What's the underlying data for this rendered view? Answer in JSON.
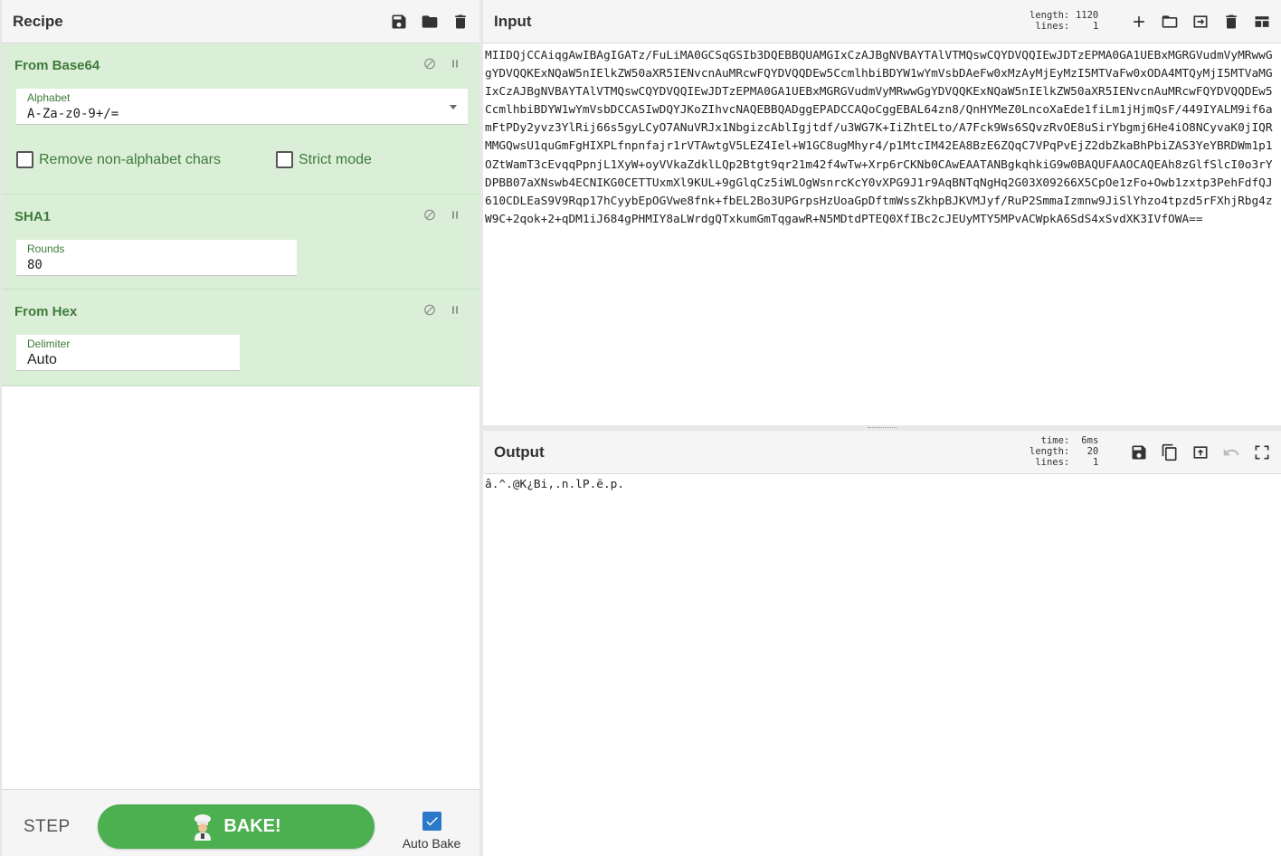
{
  "recipe": {
    "title": "Recipe",
    "header_icons": [
      "save-icon",
      "folder-icon",
      "trash-icon"
    ],
    "operations": [
      {
        "title": "From Base64",
        "alphabet_label": "Alphabet",
        "alphabet_value": "A-Za-z0-9+/=",
        "remove_non_alphabet_label": "Remove non-alphabet chars",
        "remove_non_alphabet_checked": false,
        "strict_mode_label": "Strict mode",
        "strict_mode_checked": false
      },
      {
        "title": "SHA1",
        "rounds_label": "Rounds",
        "rounds_value": "80"
      },
      {
        "title": "From Hex",
        "delimiter_label": "Delimiter",
        "delimiter_value": "Auto"
      }
    ],
    "footer": {
      "step_label": "STEP",
      "bake_label": "BAKE!",
      "auto_bake_label": "Auto Bake",
      "auto_bake_checked": true
    }
  },
  "input": {
    "title": "Input",
    "stats": {
      "length_label": "length:",
      "length_value": "1120",
      "lines_label": "lines:",
      "lines_value": "1"
    },
    "header_icons": [
      "plus-icon",
      "folder-icon",
      "import-icon",
      "trash-icon",
      "layout-icon"
    ],
    "text": "MIIDQjCCAiqgAwIBAgIGATz/FuLiMA0GCSqGSIb3DQEBBQUAMGIxCzAJBgNVBAYTAlVTMQswCQYDVQQIEwJDTzEPMA0GA1UEBxMGRGVudmVyMRwwGgYDVQQKExNQaW5nIElkZW50aXR5IENvcnAuMRcwFQYDVQQDEw5CcmlhbiBDYW1wYmVsbDAeFw0xMzAyMjEyMzI5MTVaFw0xODA4MTQyMjI5MTVaMGIxCzAJBgNVBAYTAlVTMQswCQYDVQQIEwJDTzEPMA0GA1UEBxMGRGVudmVyMRwwGgYDVQQKExNQaW5nIElkZW50aXR5IENvcnAuMRcwFQYDVQQDEw5CcmlhbiBDYW1wYmVsbDCCASIwDQYJKoZIhvcNAQEBBQADggEPADCCAQoCggEBAL64zn8/QnHYMeZ0LncoXaEde1fiLm1jHjmQsF/449IYALM9if6amFtPDy2yvz3YlRij66s5gyLCyO7ANuVRJx1NbgizcAblIgjtdf/u3WG7K+IiZhtELto/A7Fck9Ws6SQvzRvOE8uSirYbgmj6He4iO8NCyvaK0jIQRMMGQwsU1quGmFgHIXPLfnpnfajr1rVTAwtgV5LEZ4Iel+W1GC8ugMhyr4/p1MtcIM42EA8BzE6ZQqC7VPqPvEjZ2dbZkaBhPbiZAS3YeYBRDWm1p1OZtWamT3cEvqqPpnjL1XyW+oyVVkaZdklLQp2Btgt9qr21m42f4wTw+Xrp6rCKNb0CAwEAATANBgkqhkiG9w0BAQUFAAOCAQEAh8zGlfSlcI0o3rYDPBB07aXNswb4ECNIKG0CETTUxmXl9KUL+9gGlqCz5iWLOgWsnrcKcY0vXPG9J1r9AqBNTqNgHq2G03X09266X5CpOe1zFo+Owb1zxtp3PehFdfQJ610CDLEaS9V9Rqp17hCyybEpOGVwe8fnk+fbEL2Bo3UPGrpsHzUoaGpDftmWssZkhpBJKVMJyf/RuP2SmmaIzmnw9JiSlYhzo4tpzd5rFXhjRbg4zW9C+2qok+2+qDM1iJ684gPHMIY8aLWrdgQTxkumGmTqgawR+N5MDtdPTEQ0XfIBc2cJEUyMTY5MPvACWpkA6SdS4xSvdXK3IVfOWA=="
  },
  "output": {
    "title": "Output",
    "stats": {
      "time_label": "time:",
      "time_value": "6ms",
      "length_label": "length:",
      "length_value": "20",
      "lines_label": "lines:",
      "lines_value": "1"
    },
    "header_icons": [
      "save-icon",
      "copy-icon",
      "replace-input-icon",
      "undo-icon",
      "fullscreen-icon"
    ],
    "text": "â.^.@K¿Bi,.n.lP.ë.p."
  }
}
